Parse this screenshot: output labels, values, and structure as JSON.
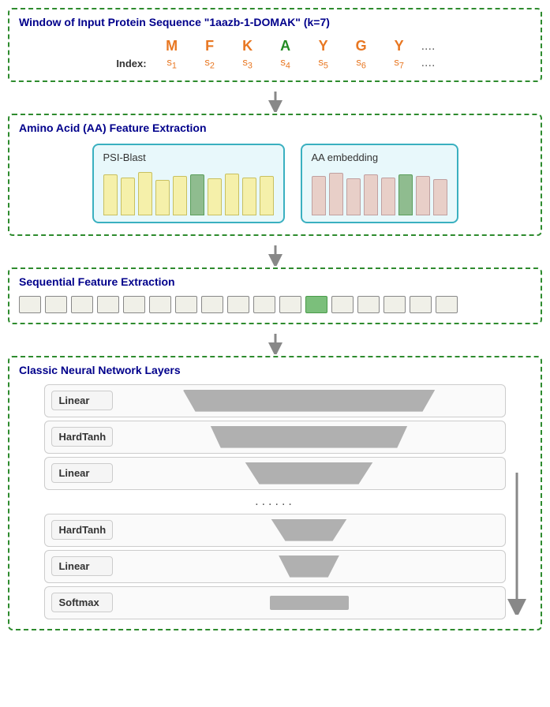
{
  "section1": {
    "title": "Window of Input Protein Sequence \"1aazb-1-DOMAK\" (k=7)",
    "residues": [
      "M",
      "F",
      "K",
      "A",
      "Y",
      "G",
      "Y"
    ],
    "colors": [
      "orange",
      "orange",
      "orange",
      "green",
      "orange",
      "orange",
      "orange"
    ],
    "indices": [
      "s₁",
      "s₂",
      "s₃",
      "s₄",
      "s₅",
      "s₆",
      "s₇"
    ],
    "dots": "....",
    "label_index": "Index:"
  },
  "section2": {
    "title": "Amino Acid (AA) Feature Extraction",
    "psi_blast_label": "PSI-Blast",
    "aa_embed_label": "AA embedding"
  },
  "section3": {
    "title": "Sequential Feature Extraction"
  },
  "section4": {
    "title": "Classic Neural Network Layers",
    "layers": [
      {
        "label": "Linear",
        "shape": "wide"
      },
      {
        "label": "HardTanh",
        "shape": "medium"
      },
      {
        "label": "Linear",
        "shape": "narrow"
      },
      {
        "label": "......",
        "shape": "dots"
      },
      {
        "label": "HardTanh",
        "shape": "very-narrow"
      },
      {
        "label": "Linear",
        "shape": "very-narrow2"
      },
      {
        "label": "Softmax",
        "shape": "small"
      }
    ]
  }
}
